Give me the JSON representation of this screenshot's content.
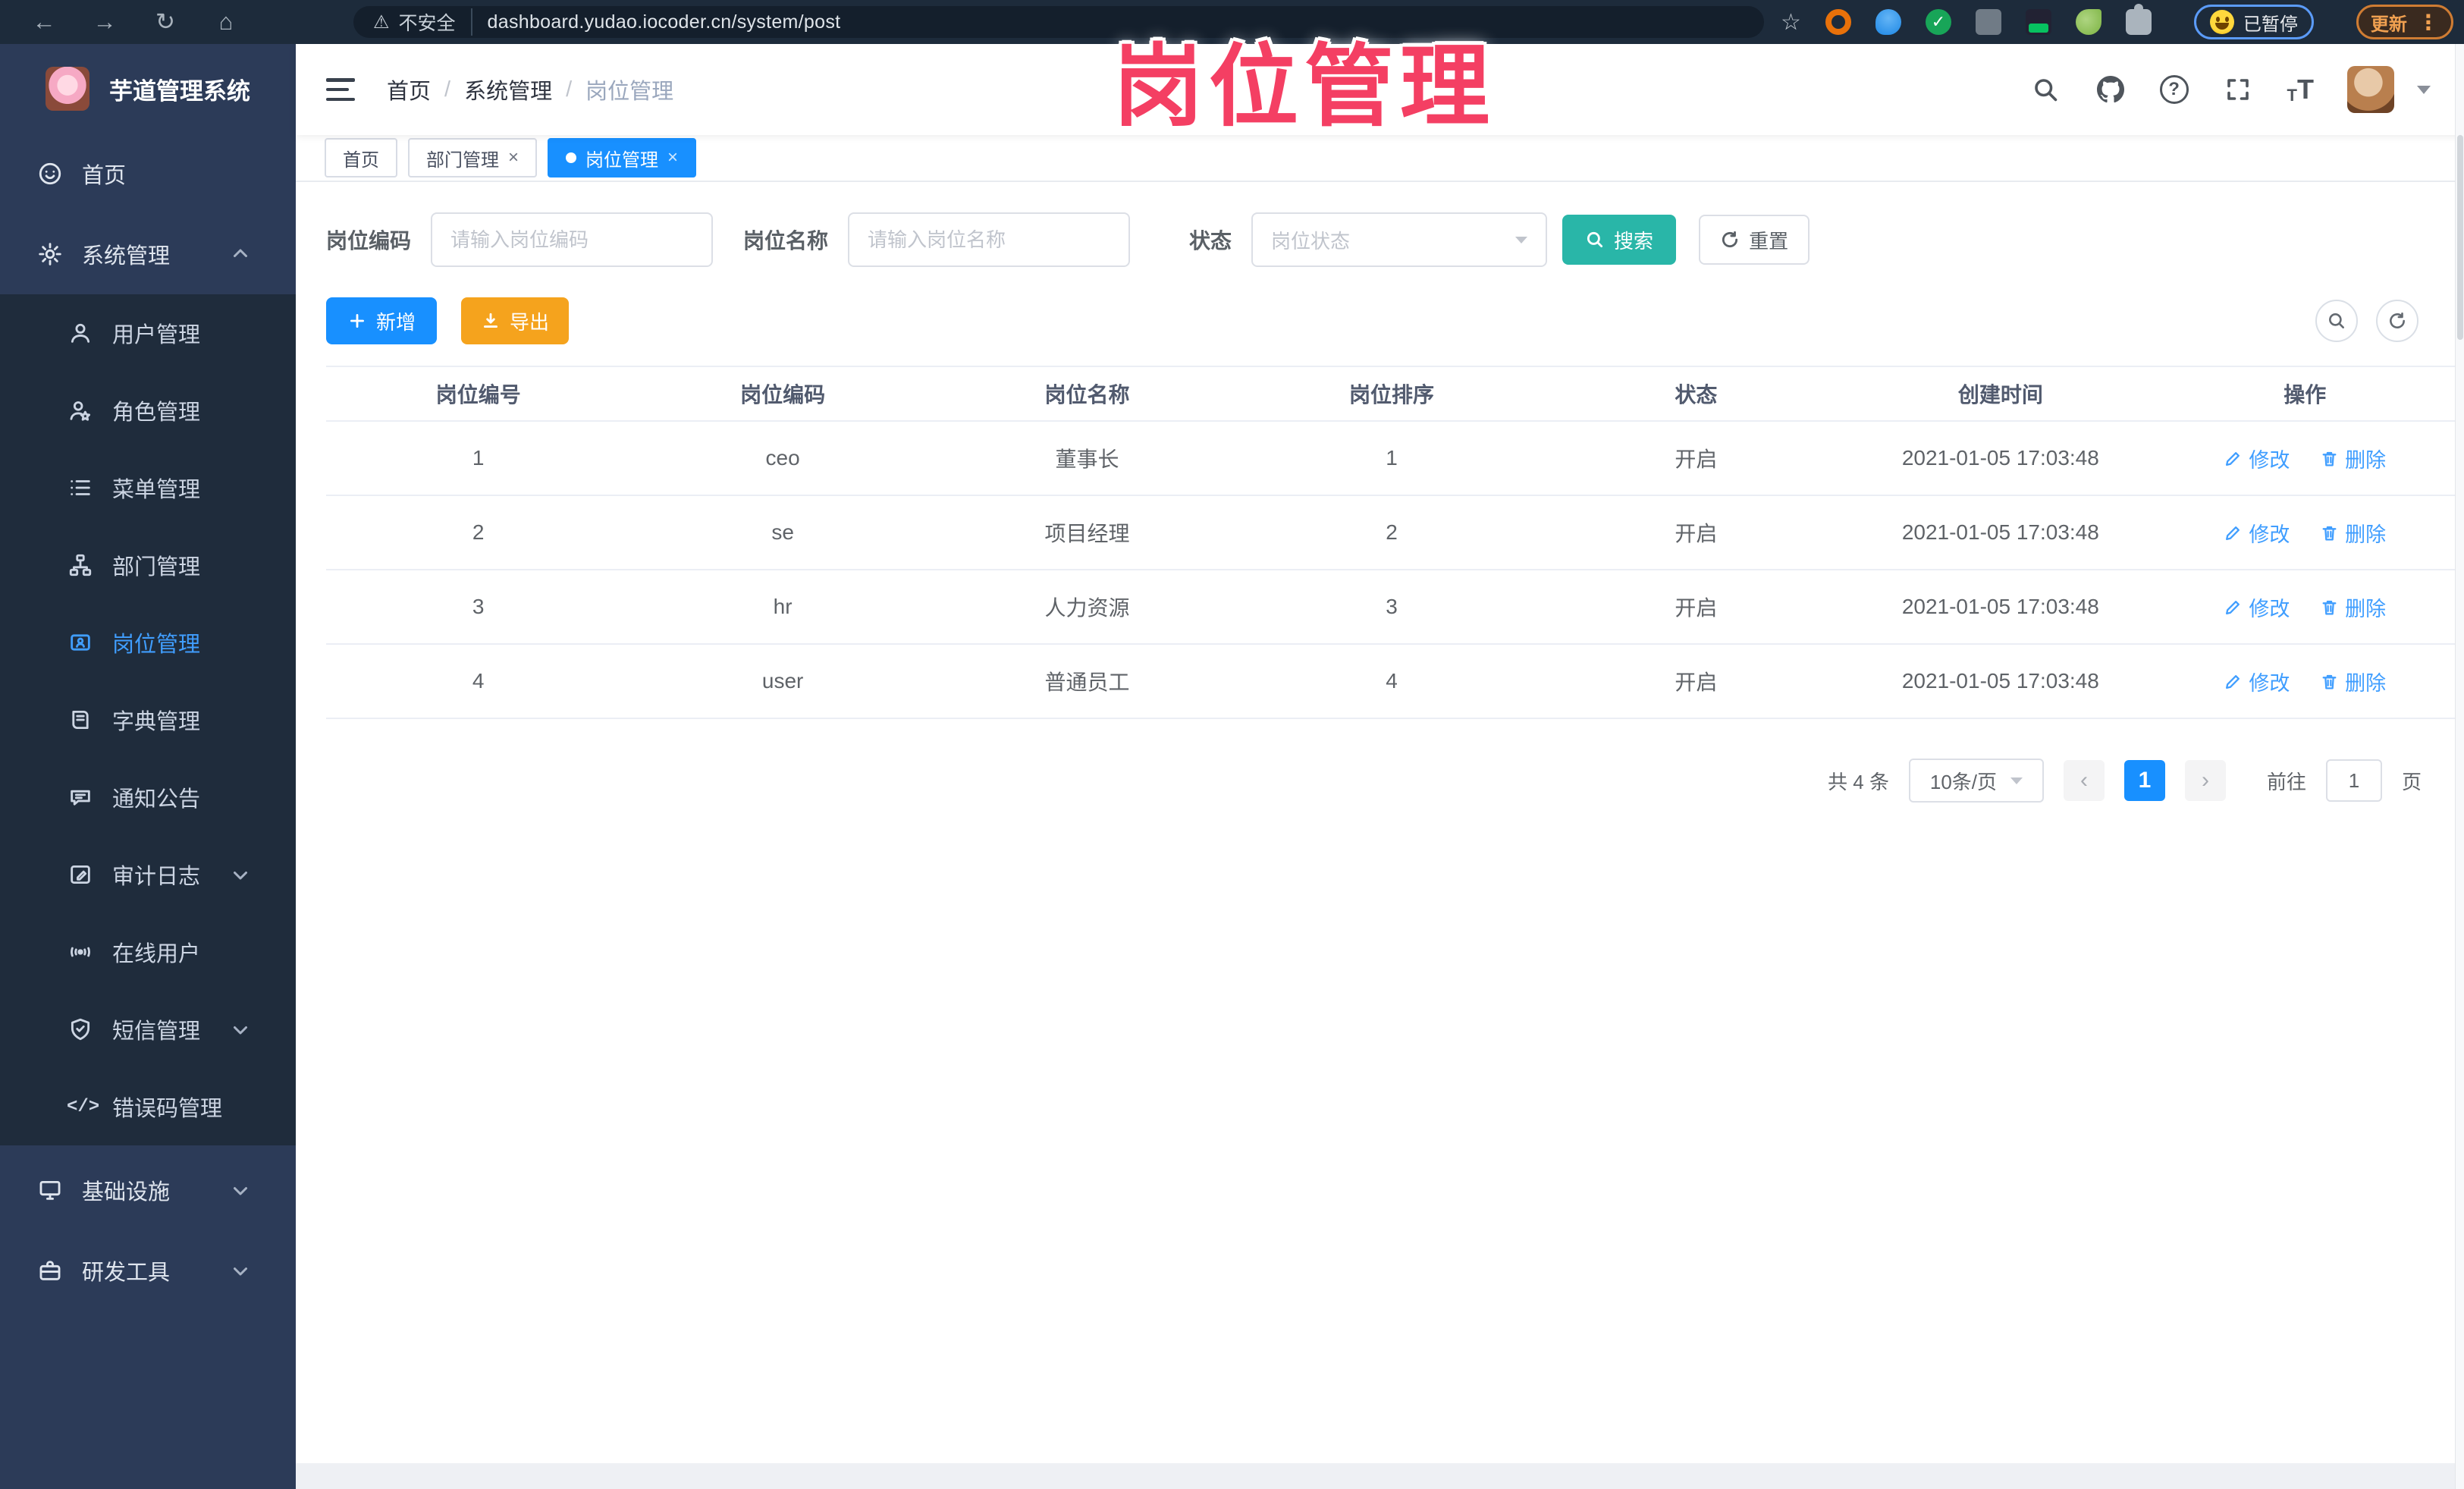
{
  "browser": {
    "security_label": "不安全",
    "url": "dashboard.yudao.iocoder.cn/system/post",
    "paused_badge": "已暂停",
    "update_button": "更新"
  },
  "watermark": "岗位管理",
  "colors": {
    "accent_blue": "#1890ff",
    "link_blue": "#409eff",
    "search_teal": "#29b6a8",
    "export_orange": "#f5a31d",
    "watermark_pink": "#f43f63",
    "sidebar_bg": "#2c3b58",
    "submenu_bg": "#1f2c3c"
  },
  "sidebar": {
    "title": "芋道管理系统",
    "items": [
      {
        "label": "首页",
        "icon": "dashboard-icon"
      },
      {
        "label": "系统管理",
        "icon": "gear-icon",
        "chevron": "up"
      },
      {
        "label": "用户管理",
        "icon": "user-icon"
      },
      {
        "label": "角色管理",
        "icon": "role-icon"
      },
      {
        "label": "菜单管理",
        "icon": "menu-list-icon"
      },
      {
        "label": "部门管理",
        "icon": "dept-tree-icon"
      },
      {
        "label": "岗位管理",
        "icon": "post-badge-icon",
        "active": true
      },
      {
        "label": "字典管理",
        "icon": "dictionary-icon"
      },
      {
        "label": "通知公告",
        "icon": "announcement-icon"
      },
      {
        "label": "审计日志",
        "icon": "audit-log-icon",
        "chevron": "down"
      },
      {
        "label": "在线用户",
        "icon": "online-user-icon"
      },
      {
        "label": "短信管理",
        "icon": "sms-shield-icon",
        "chevron": "down"
      },
      {
        "label": "错误码管理",
        "icon": "error-code-icon"
      },
      {
        "label": "基础设施",
        "icon": "infrastructure-icon",
        "chevron": "down"
      },
      {
        "label": "研发工具",
        "icon": "dev-tools-icon",
        "chevron": "down"
      }
    ]
  },
  "header": {
    "breadcrumb": [
      "首页",
      "系统管理",
      "岗位管理"
    ],
    "separator": "/"
  },
  "tabs": [
    {
      "label": "首页"
    },
    {
      "label": "部门管理"
    },
    {
      "label": "岗位管理"
    }
  ],
  "filters": {
    "code_label": "岗位编码",
    "code_placeholder": "请输入岗位编码",
    "name_label": "岗位名称",
    "name_placeholder": "请输入岗位名称",
    "status_label": "状态",
    "status_placeholder": "岗位状态",
    "search_label": "搜索",
    "reset_label": "重置"
  },
  "toolbar": {
    "add_label": "新增",
    "export_label": "导出"
  },
  "table": {
    "headers": [
      "岗位编号",
      "岗位编码",
      "岗位名称",
      "岗位排序",
      "状态",
      "创建时间",
      "操作"
    ],
    "edit_label": "修改",
    "delete_label": "删除",
    "rows": [
      {
        "id": "1",
        "code": "ceo",
        "name": "董事长",
        "sort": "1",
        "status": "开启",
        "created": "2021-01-05 17:03:48"
      },
      {
        "id": "2",
        "code": "se",
        "name": "项目经理",
        "sort": "2",
        "status": "开启",
        "created": "2021-01-05 17:03:48"
      },
      {
        "id": "3",
        "code": "hr",
        "name": "人力资源",
        "sort": "3",
        "status": "开启",
        "created": "2021-01-05 17:03:48"
      },
      {
        "id": "4",
        "code": "user",
        "name": "普通员工",
        "sort": "4",
        "status": "开启",
        "created": "2021-01-05 17:03:48"
      }
    ]
  },
  "pagination": {
    "total": "共 4 条",
    "page_size": "10条/页",
    "current_page": "1",
    "goto_label": "前往",
    "goto_value": "1",
    "page_unit": "页"
  }
}
